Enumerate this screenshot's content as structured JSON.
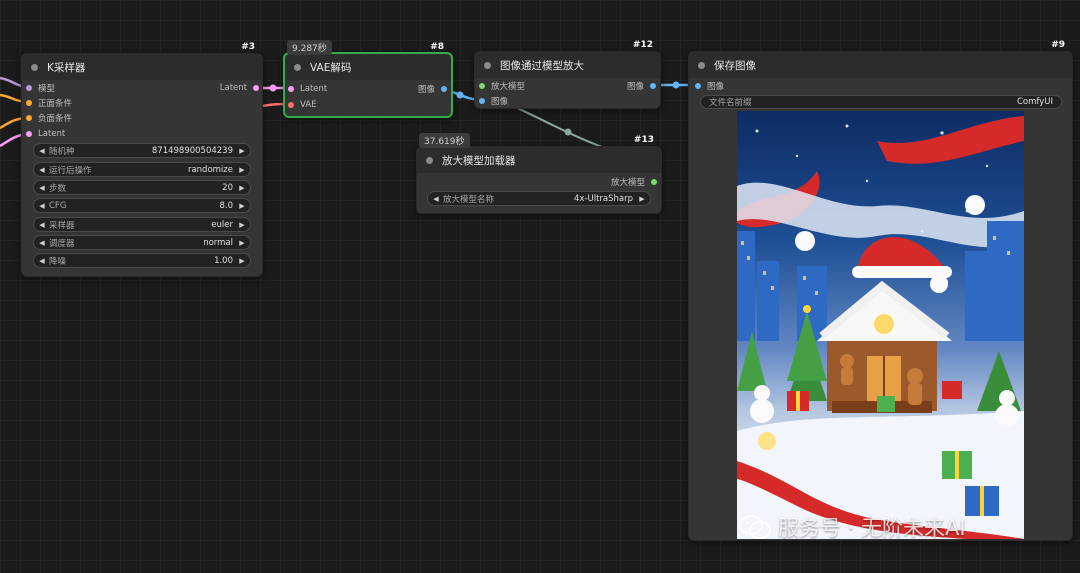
{
  "nodes": {
    "ksampler": {
      "id": "#3",
      "title": "K采样器",
      "inputs": [
        "模型",
        "正面条件",
        "负面条件",
        "Latent"
      ],
      "output": "Latent",
      "widgets": [
        {
          "label": "随机种",
          "value": "871498900504239"
        },
        {
          "label": "运行后操作",
          "value": "randomize"
        },
        {
          "label": "步数",
          "value": "20"
        },
        {
          "label": "CFG",
          "value": "8.0"
        },
        {
          "label": "采样器",
          "value": "euler"
        },
        {
          "label": "调度器",
          "value": "normal"
        },
        {
          "label": "降噪",
          "value": "1.00"
        }
      ]
    },
    "vae_decode": {
      "id": "#8",
      "time": "9.287秒",
      "title": "VAE解码",
      "inputs": [
        "Latent",
        "VAE"
      ],
      "output": "图像"
    },
    "upscale_with_model": {
      "id": "#12",
      "title": "图像通过模型放大",
      "inputs": [
        "放大模型",
        "图像"
      ],
      "output": "图像"
    },
    "upscale_model_loader": {
      "id": "#13",
      "time": "37.619秒",
      "title": "放大模型加载器",
      "output": "放大模型",
      "widget": {
        "label": "放大模型名称",
        "value": "4x-UltraSharp"
      }
    },
    "save_image": {
      "id": "#9",
      "title": "保存图像",
      "input": "图像",
      "widget": {
        "label": "文件名前缀",
        "value": "ComfyUI"
      }
    }
  },
  "watermark": {
    "text": "服务号 · 无阶未来AI"
  },
  "colors": {
    "model": "#b39ddb",
    "conditioning": "#ffa931",
    "latent": "#ff9cf9",
    "vae": "#ff6e6e",
    "image": "#64b5f6",
    "upscale_model": "#7cd86c",
    "active_border": "#2fae4a"
  }
}
